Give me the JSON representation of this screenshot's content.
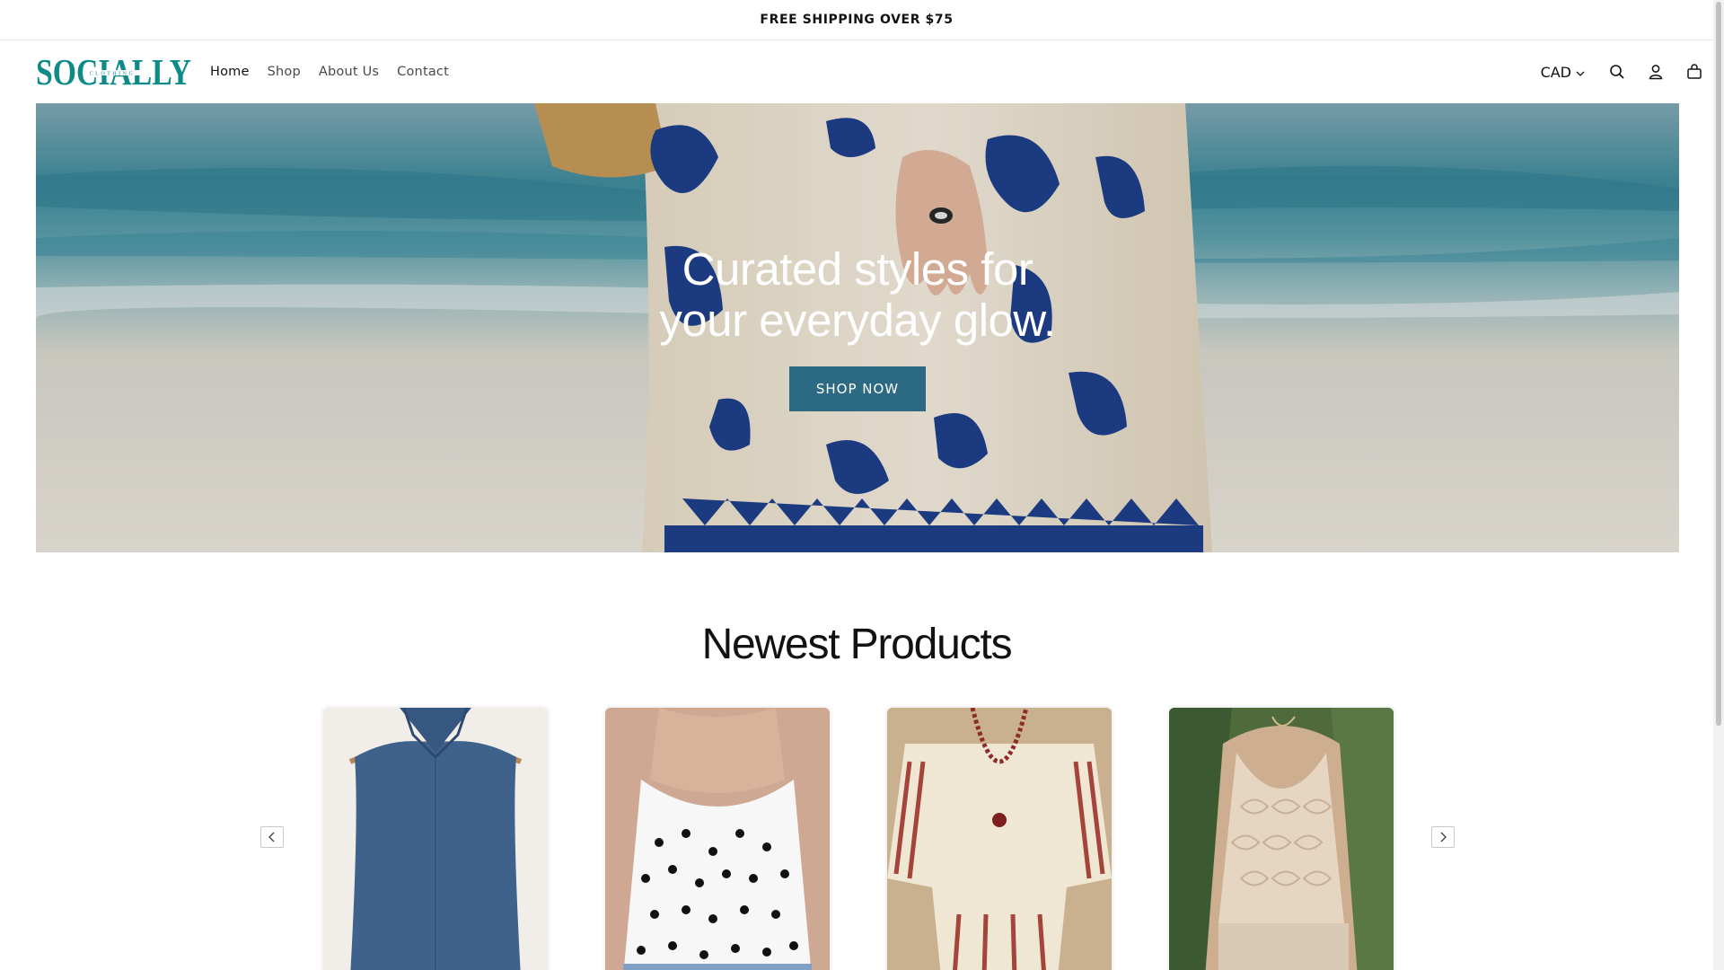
{
  "announcement": {
    "text": "FREE SHIPPING OVER $75"
  },
  "brand": {
    "logo_text": "SOCIALLY",
    "logo_subtext": "CLOTHING",
    "accent_color": "#0e8a87"
  },
  "nav": {
    "items": [
      {
        "label": "Home",
        "active": true
      },
      {
        "label": "Shop",
        "active": false
      },
      {
        "label": "About Us",
        "active": false
      },
      {
        "label": "Contact",
        "active": false
      }
    ]
  },
  "header": {
    "currency": "CAD",
    "icons": [
      "chevron-down-icon",
      "search-icon",
      "account-icon",
      "cart-icon"
    ]
  },
  "hero": {
    "heading_line1": "Curated styles for",
    "heading_line2": "your everyday glow.",
    "cta_label": "SHOP NOW",
    "cta_color": "#2b6a82"
  },
  "newest": {
    "title": "Newest Products",
    "products": [
      {
        "image": "denim sleeveless top"
      },
      {
        "image": "polka dot cowl neck cami"
      },
      {
        "image": "striped linen top with beaded necklace"
      },
      {
        "image": "crochet halter knit top"
      }
    ],
    "prev_icon": "chevron-left-icon",
    "next_icon": "chevron-right-icon"
  }
}
